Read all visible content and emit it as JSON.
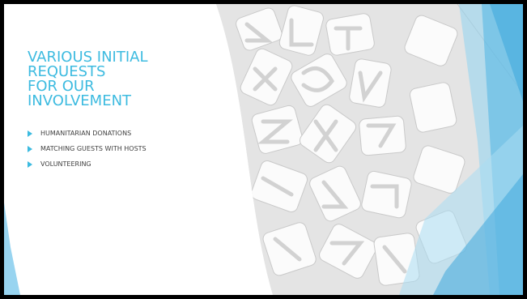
{
  "slide": {
    "title_lines": [
      "VARIOUS INITIAL",
      "REQUESTS",
      "FOR OUR",
      "INVOLVEMENT"
    ],
    "bullets": [
      {
        "label": "HUMANITARIAN DONATIONS",
        "icon": "triangle-bullet-icon"
      },
      {
        "label": "MATCHING GUESTS WITH HOSTS",
        "icon": "triangle-bullet-icon"
      },
      {
        "label": "VOLUNTEERING",
        "icon": "triangle-bullet-icon"
      }
    ],
    "image": {
      "icon": "letters-background-photo"
    }
  },
  "colors": {
    "accent": "#3DBBE0",
    "accent_light": "#8FD3F0",
    "text": "#404040",
    "background": "#ffffff",
    "frame": "#000000"
  }
}
